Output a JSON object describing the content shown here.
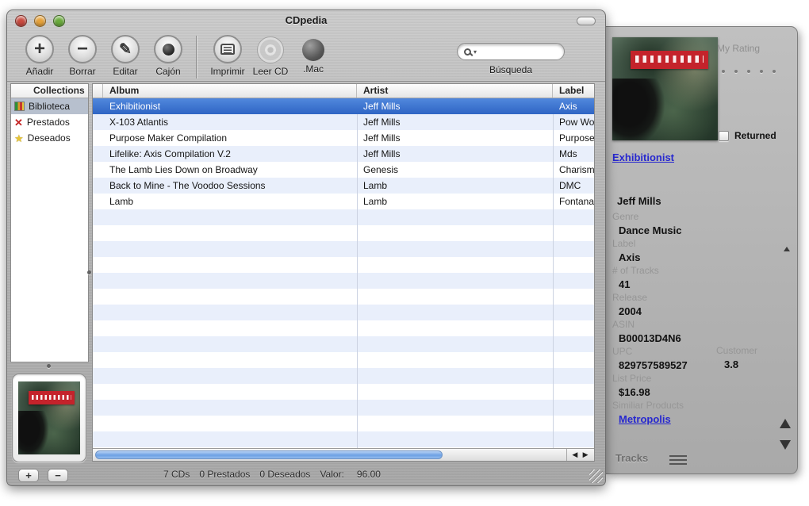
{
  "window": {
    "title": "CDpedia"
  },
  "toolbar": {
    "buttons": [
      {
        "label": "Añadir"
      },
      {
        "label": "Borrar"
      },
      {
        "label": "Editar"
      },
      {
        "label": "Cajón"
      },
      {
        "label": "Imprimir"
      },
      {
        "label": "Leer CD"
      },
      {
        "label": ".Mac"
      }
    ],
    "search": {
      "value": "",
      "label": "Búsqueda"
    }
  },
  "sidebar": {
    "header": "Collections",
    "items": [
      {
        "label": "Biblioteca",
        "selected": true
      },
      {
        "label": "Prestados"
      },
      {
        "label": "Deseados"
      }
    ],
    "add_label": "+",
    "remove_label": "−"
  },
  "table": {
    "columns": [
      "Album",
      "Artist",
      "Label"
    ],
    "rows": [
      {
        "album": "Exhibitionist",
        "artist": "Jeff Mills",
        "label": "Axis",
        "selected": true
      },
      {
        "album": "X-103 Atlantis",
        "artist": "Jeff Mills",
        "label": "Pow Wow"
      },
      {
        "album": "Purpose Maker Compilation",
        "artist": "Jeff Mills",
        "label": "Purpose"
      },
      {
        "album": "Lifelike: Axis Compilation V.2",
        "artist": "Jeff Mills",
        "label": "Mds"
      },
      {
        "album": "The Lamb Lies Down on Broadway",
        "artist": "Genesis",
        "label": "Charisma"
      },
      {
        "album": "Back to Mine - The Voodoo Sessions",
        "artist": "Lamb",
        "label": "DMC"
      },
      {
        "album": "Lamb",
        "artist": "Lamb",
        "label": "Fontana"
      }
    ]
  },
  "status": {
    "cds": "7 CDs",
    "prestados": "0 Prestados",
    "deseados": "0 Deseados",
    "valor_label": "Valor:",
    "valor": "96.00"
  },
  "drawer": {
    "my_rating_label": "My Rating",
    "returned_label": "Returned",
    "album_title_link": "Exhibitionist",
    "artist": "Jeff Mills",
    "fields": [
      {
        "label": "Genre",
        "value": "Dance Music"
      },
      {
        "label": "Label",
        "value": "Axis"
      },
      {
        "label": "# of Tracks",
        "value": "41"
      },
      {
        "label": "Release",
        "value": "2004"
      },
      {
        "label": "ASIN",
        "value": "B00013D4N6"
      },
      {
        "label": "UPC",
        "value": "829757589527"
      },
      {
        "label": "List Price",
        "value": "$16.98"
      }
    ],
    "customer_label": "Customer",
    "customer_value": "3.8",
    "similar_label": "Similiar Products",
    "similar_link": "Metropolis",
    "tracks_label": "Tracks"
  },
  "colors": {
    "selection_blue": "#3473d5",
    "row_stripe_blue": "#e9effb",
    "link_blue": "#2728cf",
    "traffic_close": "#c94b40",
    "traffic_minimize": "#e6a23b",
    "traffic_zoom": "#6aab3c"
  },
  "icons": {
    "plus": "+",
    "minus": "−",
    "pencil": "✎",
    "search_caret": "▾",
    "scroll_left": "◀",
    "scroll_right": "▶",
    "red_x": "✕",
    "star": "★"
  }
}
